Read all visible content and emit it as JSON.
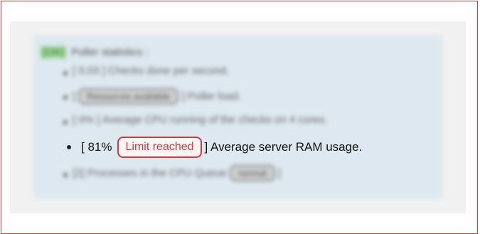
{
  "panel": {
    "heading_tag": "[OK]",
    "heading_text": "Poller statistics :"
  },
  "stats": [
    {
      "text": "[ 0,03 ] Checks done per second."
    },
    {
      "prefix": "[",
      "badge": "Resources available",
      "suffix": "] Poller load."
    },
    {
      "text": "[ 0% ] Average CPU running of the checks on 4 cores."
    },
    {
      "prefix": "[ 81%",
      "badge": "Limit reached",
      "suffix": "] Average server RAM usage."
    },
    {
      "prefix": "[2] Processes in the CPU Queue",
      "badge": "normal",
      "suffix": "]"
    }
  ],
  "colors": {
    "alert": "#d9363e",
    "panel_bg": "#dde8f0",
    "frame_border": "#d63a3a"
  }
}
